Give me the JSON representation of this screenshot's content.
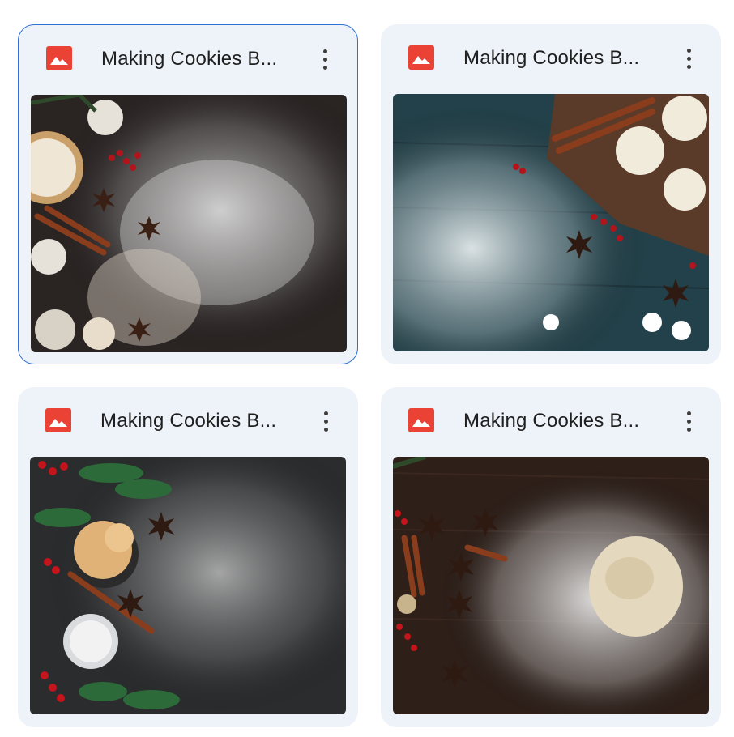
{
  "files": [
    {
      "title": "Making Cookies B...",
      "type_icon": "image-file-icon",
      "selected": true
    },
    {
      "title": "Making Cookies B...",
      "type_icon": "image-file-icon",
      "selected": false
    },
    {
      "title": "Making Cookies B...",
      "type_icon": "image-file-icon",
      "selected": false
    },
    {
      "title": "Making Cookies B...",
      "type_icon": "image-file-icon",
      "selected": false
    }
  ],
  "colors": {
    "icon_red": "#ea4335",
    "selected_border": "#2f6fd6",
    "card_bg": "#eef2f9"
  }
}
